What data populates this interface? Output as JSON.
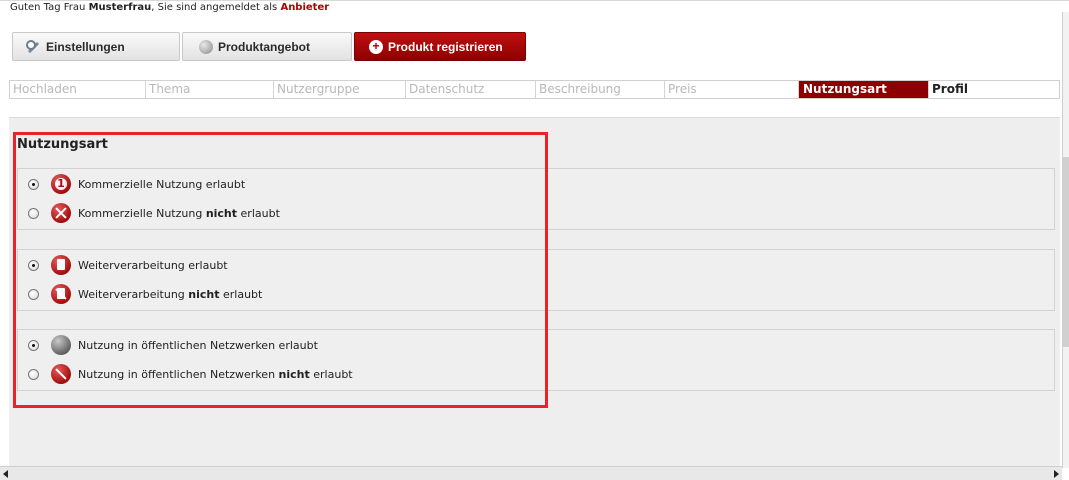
{
  "greeting": {
    "prefix": "Guten Tag Frau ",
    "name": "Musterfrau",
    "middle": ", Sie sind angemeldet als ",
    "role": "Anbieter"
  },
  "nav": {
    "settings_label": "Einstellungen",
    "product_offer_label": "Produktangebot",
    "register_label": "Produkt registrieren"
  },
  "steps": [
    {
      "label": "Hochladen"
    },
    {
      "label": "Thema"
    },
    {
      "label": "Nutzergruppe"
    },
    {
      "label": "Datenschutz"
    },
    {
      "label": "Beschreibung"
    },
    {
      "label": "Preis"
    },
    {
      "label": "Nutzungsart"
    },
    {
      "label": "Profil"
    }
  ],
  "section": {
    "title": "Nutzungsart",
    "groups": [
      {
        "options": [
          {
            "pre": "Kommerzielle Nutzung erlaubt",
            "bold": "",
            "post": "",
            "checked": true,
            "icon": "license-1-icon"
          },
          {
            "pre": "Kommerzielle Nutzung ",
            "bold": "nicht",
            "post": " erlaubt",
            "checked": false,
            "icon": "no-commercial-icon"
          }
        ]
      },
      {
        "options": [
          {
            "pre": "Weiterverarbeitung erlaubt",
            "bold": "",
            "post": "",
            "checked": true,
            "icon": "derivative-icon"
          },
          {
            "pre": "Weiterverarbeitung ",
            "bold": "nicht",
            "post": " erlaubt",
            "checked": false,
            "icon": "no-derivative-icon"
          }
        ]
      },
      {
        "options": [
          {
            "pre": "Nutzung in öffentlichen Netzwerken erlaubt",
            "bold": "",
            "post": "",
            "checked": true,
            "icon": "network-icon"
          },
          {
            "pre": "Nutzung in öffentlichen Netzwerken ",
            "bold": "nicht",
            "post": " erlaubt",
            "checked": false,
            "icon": "no-network-icon"
          }
        ]
      }
    ]
  },
  "colors": {
    "accent": "#8e0000",
    "highlight": "#e8232a"
  }
}
